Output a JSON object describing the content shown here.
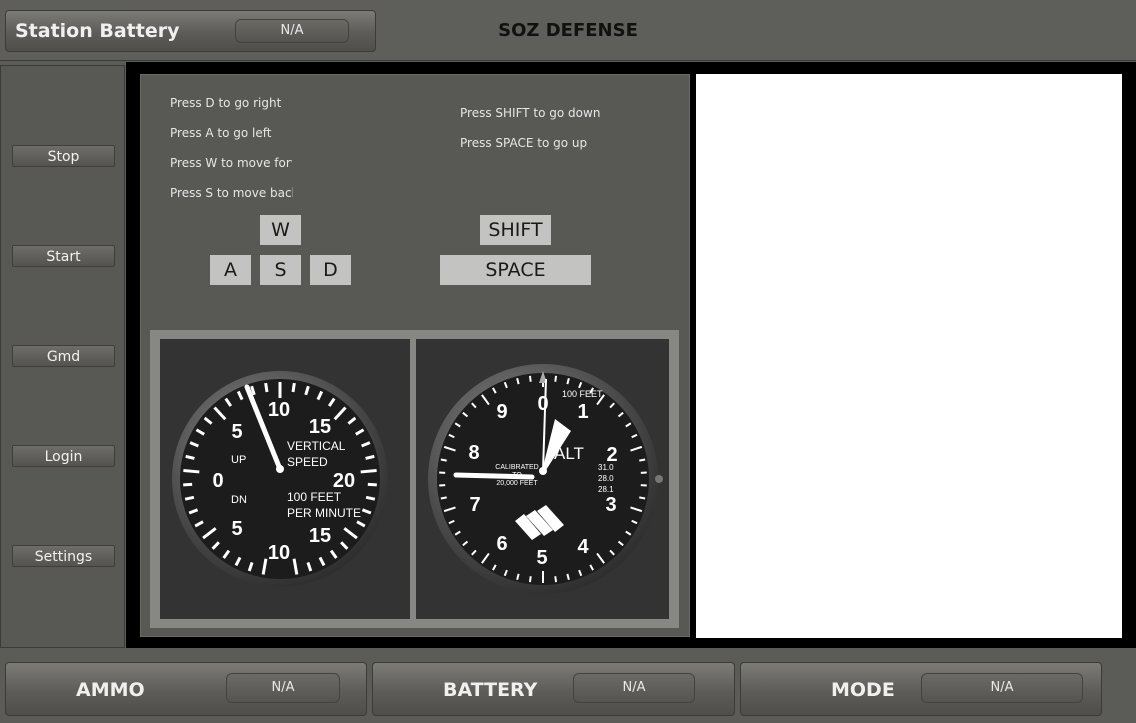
{
  "header": {
    "battery_label": "Station Battery",
    "battery_value": "N/A",
    "title": "SOZ DEFENSE"
  },
  "sidebar": {
    "buttons": [
      "Stop",
      "Start",
      "Gmd",
      "Login",
      "Settings"
    ]
  },
  "controls": {
    "hints_left": [
      "Press D to go right",
      "Press A to go left",
      "Press W to move forward",
      "Press S to move back"
    ],
    "hints_right": [
      "Press SHIFT to go down",
      "Press SPACE to go up"
    ],
    "keys": {
      "w": "W",
      "a": "A",
      "s": "S",
      "d": "D",
      "shift": "SHIFT",
      "space": "SPACE"
    }
  },
  "vsi": {
    "title_lines": [
      "VERTICAL",
      "SPEED"
    ],
    "unit_lines": [
      "100 FEET",
      "PER MINUTE"
    ],
    "up": "UP",
    "dn": "DN",
    "numerals": [
      "10",
      "15",
      "20",
      "15",
      "10",
      "5",
      "0",
      "5"
    ]
  },
  "altimeter": {
    "label": "ALT",
    "calib_lines": [
      "CALIBRATED",
      "TO",
      "20,000 FEET"
    ],
    "feet": "100 FEET",
    "numerals": [
      "0",
      "1",
      "2",
      "3",
      "4",
      "5",
      "6",
      "7",
      "8",
      "9"
    ],
    "kollsman": [
      "31.0",
      "28.0",
      "28.1"
    ]
  },
  "status": {
    "ammo_label": "AMMO",
    "ammo_value": "N/A",
    "battery_label": "BATTERY",
    "battery_value": "N/A",
    "mode_label": "MODE",
    "mode_value": "N/A"
  }
}
